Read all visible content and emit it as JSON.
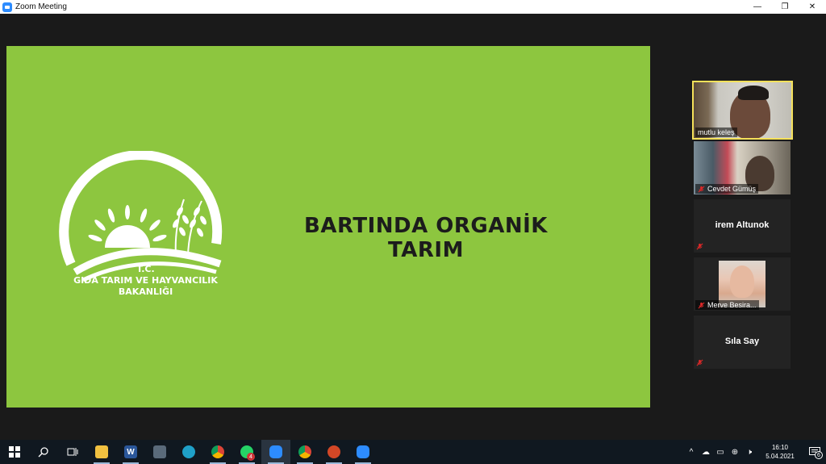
{
  "window": {
    "title": "Zoom Meeting",
    "minimize": "—",
    "restore": "❐",
    "close": "✕"
  },
  "slide": {
    "title": "BARTINDA ORGANİK TARIM",
    "background": "#8dc63f",
    "logo_line1": "T.C.",
    "logo_line2": "GIDA TARIM VE HAYVANCILIK",
    "logo_line3": "BAKANLIĞI"
  },
  "participants": [
    {
      "name": "mutlu keleş",
      "video": true,
      "active": true,
      "muted": false
    },
    {
      "name": "Cevdet Gümüş",
      "video": true,
      "active": false,
      "muted": true
    },
    {
      "name": "irem Altunok",
      "video": false,
      "active": false,
      "muted": true
    },
    {
      "name": "Merve Besira...",
      "video": false,
      "photo": true,
      "active": false,
      "muted": true
    },
    {
      "name": "Sıla Say",
      "video": false,
      "active": false,
      "muted": true
    }
  ],
  "taskbar": {
    "apps": [
      "start-icon",
      "search-icon",
      "task-view-icon",
      "file-explorer-icon",
      "word-icon",
      "calculator-icon",
      "edge-icon",
      "chrome-icon",
      "whatsapp-icon",
      "zoom-icon",
      "chrome-icon",
      "powerpoint-icon",
      "zoom-icon"
    ],
    "whatsapp_badge": "4",
    "time": "16:10",
    "date": "5.04.2021",
    "notification_count": "6"
  },
  "colors": {
    "active_speaker_border": "#f5e15a",
    "zoom_blue": "#2d8cff",
    "mute_red": "#e02828"
  }
}
